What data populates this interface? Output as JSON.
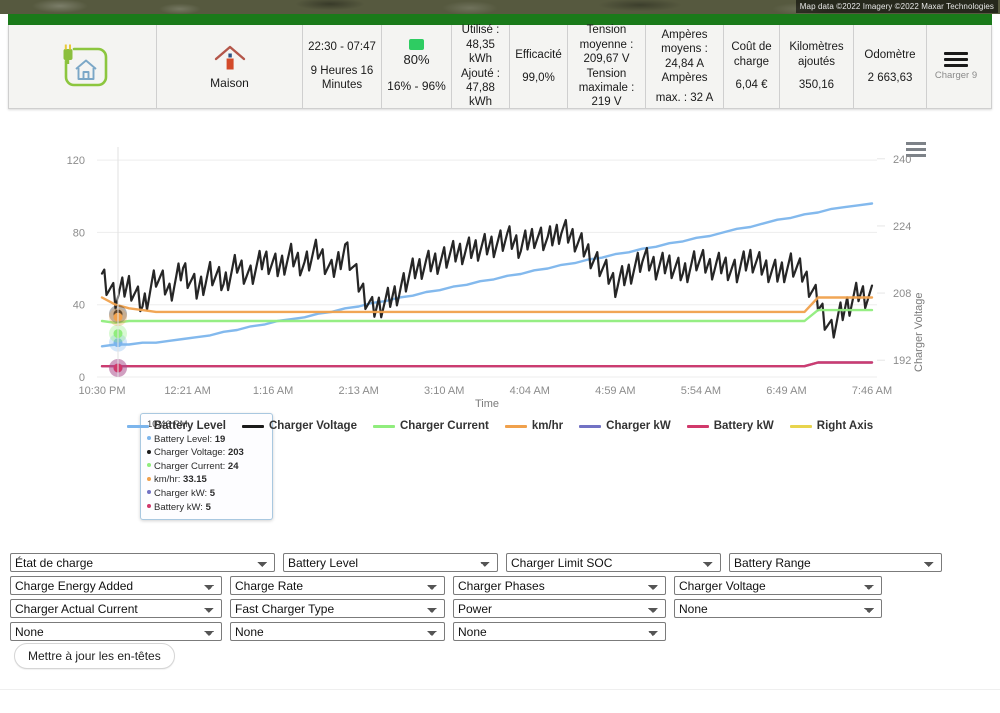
{
  "map_strip": {
    "attribution": "Map data ©2022 Imagery ©2022 Maxar Technologies"
  },
  "summary": {
    "plug_house_icon": "plug-house-icon",
    "location_icon": "home-icon",
    "location_label": "Maison",
    "time_range": "22:30 - 07:47",
    "duration": "9 Heures 16 Minutes",
    "soc_target": "80%",
    "soc_range": "16% - 96%",
    "used_label": "Utilisé :",
    "used_value": "48,35 kWh",
    "added_label": "Ajouté :",
    "added_value": "47,88 kWh",
    "efficiency_label": "Efficacité",
    "efficiency_value": "99,0%",
    "avg_voltage_label": "Tension moyenne :",
    "avg_voltage_value": "209,67 V",
    "max_voltage_label": "Tension maximale :",
    "max_voltage_value": "219 V",
    "avg_amps_label": "Ampères moyens :",
    "avg_amps_value": "24,84 A Ampères",
    "max_amps_value": "max. : 32 A",
    "cost_label": "Coût de charge",
    "cost_value": "6,04 €",
    "km_added_label": "Kilomètres ajoutés",
    "km_added_value": "350,16",
    "odometer_label": "Odomètre",
    "odometer_value": "2 663,63",
    "menu_icon": "hamburger-menu-icon",
    "charger_label": "Charger 9"
  },
  "chart_data": {
    "type": "line",
    "title": "",
    "xlabel": "Time",
    "ylabel": "",
    "y2label": "Charger Voltage",
    "ylim": [
      0,
      130
    ],
    "yticks": [
      0,
      40,
      80,
      120
    ],
    "y2lim": [
      188,
      244
    ],
    "y2ticks": [
      192,
      208,
      224,
      240
    ],
    "grid": true,
    "legend_position": "bottom",
    "xticks": [
      "10:30 PM",
      "12:21 AM",
      "1:16 AM",
      "2:13 AM",
      "3:10 AM",
      "4:04 AM",
      "4:59 AM",
      "5:54 AM",
      "6:49 AM",
      "7:46 AM"
    ],
    "colors": {
      "battery_level": "#7cb5ec",
      "charger_voltage": "#1a1a1a",
      "charger_current": "#90ed7d",
      "km_hr": "#f0a14c",
      "charger_kw": "#7272c4",
      "battery_kw": "#d1396b",
      "right_axis": "#e8d44d"
    },
    "series": [
      {
        "name": "Battery Level",
        "color": "#7cb5ec",
        "axis": "left",
        "values": [
          17,
          18,
          18,
          19,
          19,
          20,
          21,
          22,
          23,
          25,
          26,
          28,
          29,
          31,
          32,
          33,
          35,
          36,
          38,
          39,
          41,
          42,
          44,
          45,
          47,
          48,
          50,
          51,
          53,
          54,
          56,
          57,
          59,
          60,
          62,
          63,
          65,
          66,
          68,
          69,
          71,
          72,
          74,
          75,
          77,
          78,
          80,
          82,
          83,
          85,
          87,
          88,
          90,
          91,
          93,
          94,
          95,
          96
        ]
      },
      {
        "name": "Charger Voltage",
        "color": "#1a1a1a",
        "axis": "right",
        "values": [
          213,
          207,
          210,
          205,
          212,
          208,
          214,
          209,
          213,
          210,
          215,
          212,
          216,
          214,
          217,
          215,
          218,
          213,
          219,
          210,
          204,
          206,
          209,
          213,
          215,
          216,
          217,
          218,
          219,
          220,
          221,
          219,
          222,
          220,
          223,
          221,
          218,
          214,
          210,
          213,
          216,
          214,
          215,
          213,
          216,
          214,
          215,
          213,
          216,
          214,
          213,
          215,
          212,
          206,
          199,
          204,
          208,
          207
        ]
      },
      {
        "name": "Charger Current",
        "color": "#90ed7d",
        "axis": "left",
        "values": [
          31,
          30,
          31,
          31,
          31,
          31,
          31,
          31,
          31,
          31,
          31,
          31,
          31,
          31,
          31,
          31,
          31,
          31,
          31,
          31,
          31,
          31,
          31,
          31,
          31,
          31,
          31,
          31,
          31,
          31,
          31,
          31,
          31,
          31,
          31,
          31,
          31,
          31,
          31,
          31,
          31,
          31,
          31,
          31,
          31,
          31,
          31,
          31,
          31,
          31,
          31,
          31,
          31,
          37,
          37,
          37,
          37,
          37
        ]
      },
      {
        "name": "km/hr",
        "color": "#f0a14c",
        "axis": "left",
        "values": [
          44,
          40,
          38,
          37,
          36,
          36,
          36,
          36,
          36,
          36,
          36,
          36,
          36,
          36,
          36,
          36,
          36,
          36,
          36,
          36,
          36,
          36,
          36,
          36,
          36,
          36,
          36,
          36,
          36,
          36,
          36,
          36,
          36,
          36,
          36,
          36,
          36,
          36,
          36,
          36,
          36,
          36,
          36,
          36,
          36,
          36,
          36,
          36,
          36,
          36,
          36,
          36,
          36,
          44,
          44,
          44,
          44,
          44
        ]
      },
      {
        "name": "Charger kW",
        "color": "#7272c4",
        "axis": "left",
        "values": [
          6,
          6,
          6,
          6,
          6,
          6,
          6,
          6,
          6,
          6,
          6,
          6,
          6,
          6,
          6,
          6,
          6,
          6,
          6,
          6,
          6,
          6,
          6,
          6,
          6,
          6,
          6,
          6,
          6,
          6,
          6,
          6,
          6,
          6,
          6,
          6,
          6,
          6,
          6,
          6,
          6,
          6,
          6,
          6,
          6,
          6,
          6,
          6,
          6,
          6,
          6,
          6,
          6,
          8,
          8,
          8,
          8,
          8
        ]
      },
      {
        "name": "Battery kW",
        "color": "#d1396b",
        "axis": "left",
        "values": [
          6,
          6,
          6,
          6,
          6,
          6,
          6,
          6,
          6,
          6,
          6,
          6,
          6,
          6,
          6,
          6,
          6,
          6,
          6,
          6,
          6,
          6,
          6,
          6,
          6,
          6,
          6,
          6,
          6,
          6,
          6,
          6,
          6,
          6,
          6,
          6,
          6,
          6,
          6,
          6,
          6,
          6,
          6,
          6,
          6,
          6,
          6,
          6,
          6,
          6,
          6,
          6,
          6,
          8,
          8,
          8,
          8,
          8
        ]
      },
      {
        "name": "Right Axis",
        "color": "#e8d44d",
        "axis": "right",
        "values": []
      }
    ],
    "legend": [
      {
        "label": "Battery Level",
        "color": "#7cb5ec"
      },
      {
        "label": "Charger Voltage",
        "color": "#1a1a1a"
      },
      {
        "label": "Charger Current",
        "color": "#90ed7d"
      },
      {
        "label": "km/hr",
        "color": "#f0a14c"
      },
      {
        "label": "Charger kW",
        "color": "#7272c4"
      },
      {
        "label": "Battery kW",
        "color": "#d1396b"
      },
      {
        "label": "Right Axis",
        "color": "#e8d44d"
      }
    ],
    "tooltip": {
      "time": "10:46 PM",
      "rows": [
        {
          "label": "Battery Level:",
          "value": "19",
          "color": "#7cb5ec"
        },
        {
          "label": "Charger Voltage:",
          "value": "203",
          "color": "#1a1a1a"
        },
        {
          "label": "Charger Current:",
          "value": "24",
          "color": "#90ed7d"
        },
        {
          "label": "km/hr:",
          "value": "33.15",
          "color": "#f0a14c"
        },
        {
          "label": "Charger kW:",
          "value": "5",
          "color": "#7272c4"
        },
        {
          "label": "Battery kW:",
          "value": "5",
          "color": "#d1396b"
        }
      ]
    },
    "context_menu_icon": "chart-menu-icon"
  },
  "selects": {
    "rows": [
      [
        {
          "name": "select-etat-de-charge",
          "value": "État de charge"
        },
        {
          "name": "select-battery-level",
          "value": "Battery Level"
        },
        {
          "name": "select-charger-limit-soc",
          "value": "Charger Limit SOC"
        },
        {
          "name": "select-battery-range",
          "value": "Battery Range"
        }
      ],
      [
        {
          "name": "select-charge-energy-added",
          "value": "Charge Energy Added"
        },
        {
          "name": "select-charge-rate",
          "value": "Charge Rate"
        },
        {
          "name": "select-charger-phases",
          "value": "Charger Phases"
        },
        {
          "name": "select-charger-voltage",
          "value": "Charger Voltage"
        }
      ],
      [
        {
          "name": "select-charger-actual-current",
          "value": "Charger Actual Current"
        },
        {
          "name": "select-fast-charger-type",
          "value": "Fast Charger Type"
        },
        {
          "name": "select-power",
          "value": "Power"
        },
        {
          "name": "select-none-r3",
          "value": "None"
        }
      ],
      [
        {
          "name": "select-none-a",
          "value": "None"
        },
        {
          "name": "select-none-b",
          "value": "None"
        },
        {
          "name": "select-none-c",
          "value": "None"
        }
      ]
    ]
  },
  "update_button": {
    "label": "Mettre à jour les en-têtes"
  }
}
